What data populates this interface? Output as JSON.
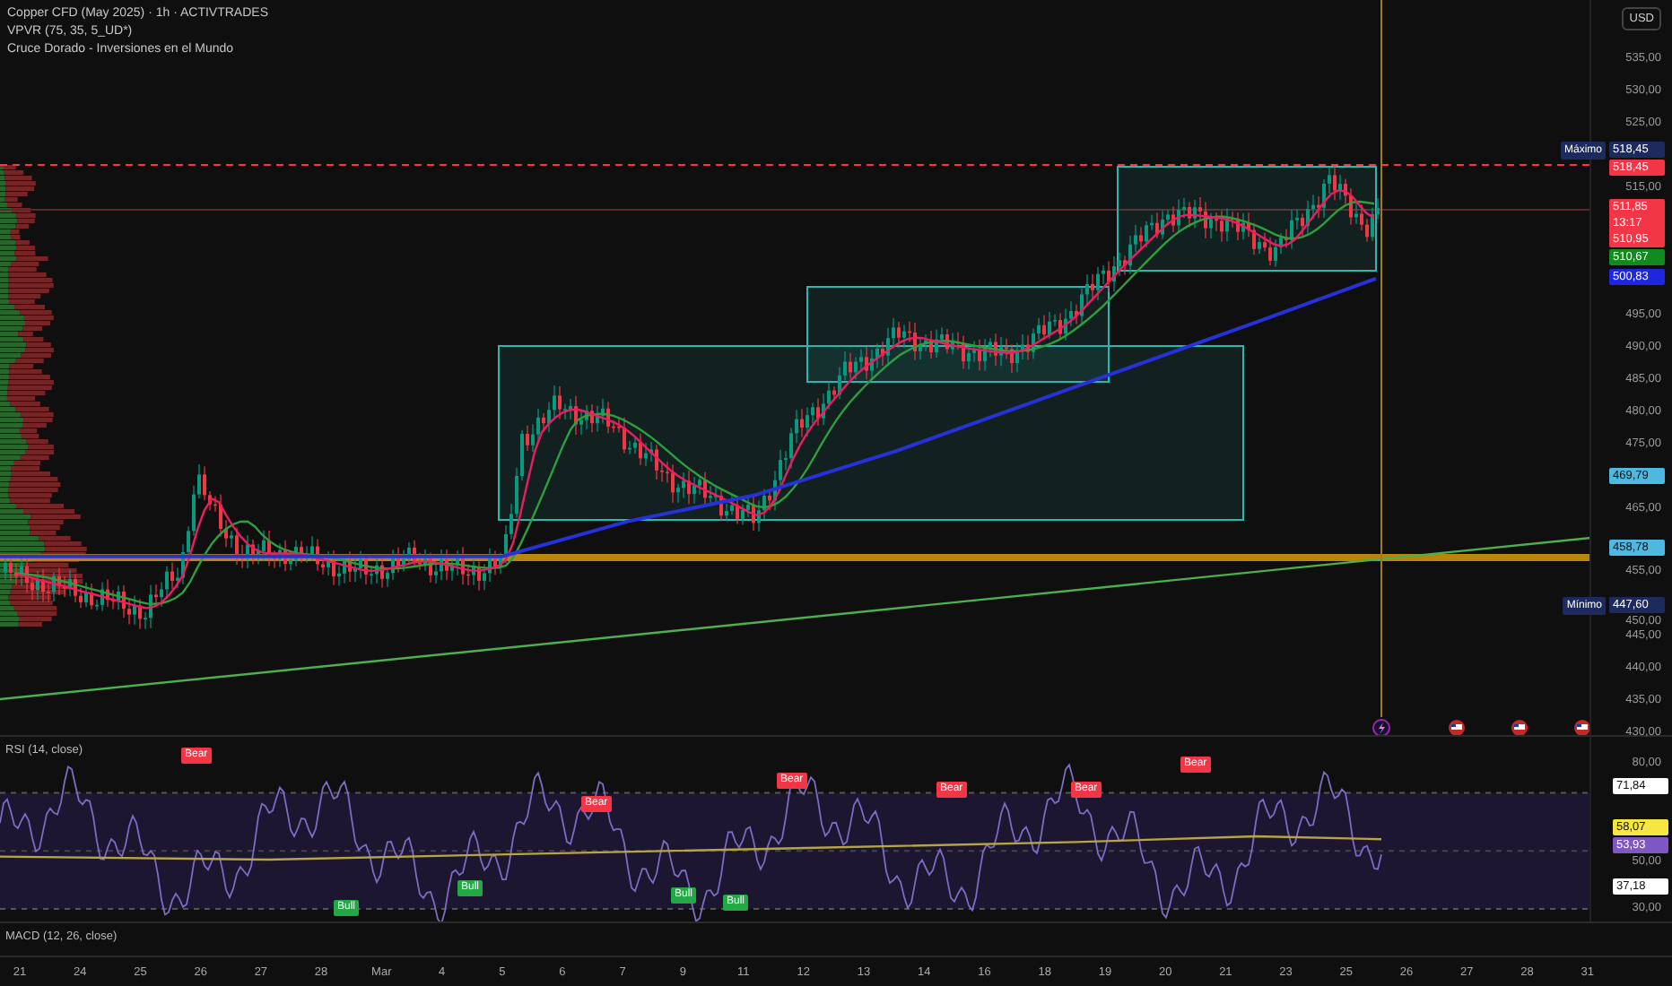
{
  "header": {
    "title": "Copper CFD (May 2025) · 1h · ACTIVTRADES",
    "indicators": [
      "VPVR (75, 35, 5_UD*)",
      "Cruce Dorado - Inversiones en el Mundo"
    ]
  },
  "price_axis": {
    "currency": "USD",
    "ticks": [
      "535,00",
      "530,00",
      "525,00",
      "515,00",
      "495,00",
      "490,00",
      "485,00",
      "480,00",
      "475,00",
      "465,00",
      "455,00",
      "450,00",
      "445,00",
      "440,00",
      "435,00",
      "430,00"
    ],
    "tags": [
      {
        "label": "Máximo",
        "lines": [
          "518,45"
        ],
        "color": "#1c2a5e"
      },
      {
        "lines": [
          "518,45"
        ],
        "color": "#f23645"
      },
      {
        "lines": [
          "511,85",
          "13:17",
          "510,95"
        ],
        "color": "#f23645"
      },
      {
        "lines": [
          "510,67"
        ],
        "color": "#138a1e"
      },
      {
        "lines": [
          "500,83"
        ],
        "color": "#1f26e0"
      },
      {
        "lines": [
          "469,79"
        ],
        "color": "#4fb8e0"
      },
      {
        "lines": [
          "458,78"
        ],
        "color": "#4fb8e0"
      },
      {
        "label": "Mínimo",
        "lines": [
          "447,60"
        ],
        "color": "#1c2a5e"
      }
    ]
  },
  "rsi": {
    "title": "RSI (14, close)",
    "ticks": [
      "80,00",
      "50,00",
      "30,00"
    ],
    "tags": [
      {
        "lines": [
          "71,84"
        ],
        "color": "#ffffff"
      },
      {
        "lines": [
          "58,07"
        ],
        "color": "#f5e642"
      },
      {
        "lines": [
          "53,93"
        ],
        "color": "#7e57c2"
      },
      {
        "lines": [
          "37,18"
        ],
        "color": "#ffffff"
      }
    ],
    "signals": [
      {
        "text": "Bear",
        "kind": "bear"
      },
      {
        "text": "Bull",
        "kind": "bull"
      },
      {
        "text": "Bull",
        "kind": "bull"
      },
      {
        "text": "Bear",
        "kind": "bear"
      },
      {
        "text": "Bull",
        "kind": "bull"
      },
      {
        "text": "Bull",
        "kind": "bull"
      },
      {
        "text": "Bear",
        "kind": "bear"
      },
      {
        "text": "Bear",
        "kind": "bear"
      },
      {
        "text": "Bear",
        "kind": "bear"
      },
      {
        "text": "Bear",
        "kind": "bear"
      }
    ]
  },
  "macd": {
    "title": "MACD (12, 26, close)"
  },
  "time_axis": [
    "21",
    "24",
    "25",
    "26",
    "27",
    "28",
    "Mar",
    "4",
    "5",
    "6",
    "7",
    "9",
    "11",
    "12",
    "13",
    "14",
    "16",
    "18",
    "19",
    "20",
    "21",
    "23",
    "25",
    "26",
    "27",
    "28",
    "31"
  ]
}
